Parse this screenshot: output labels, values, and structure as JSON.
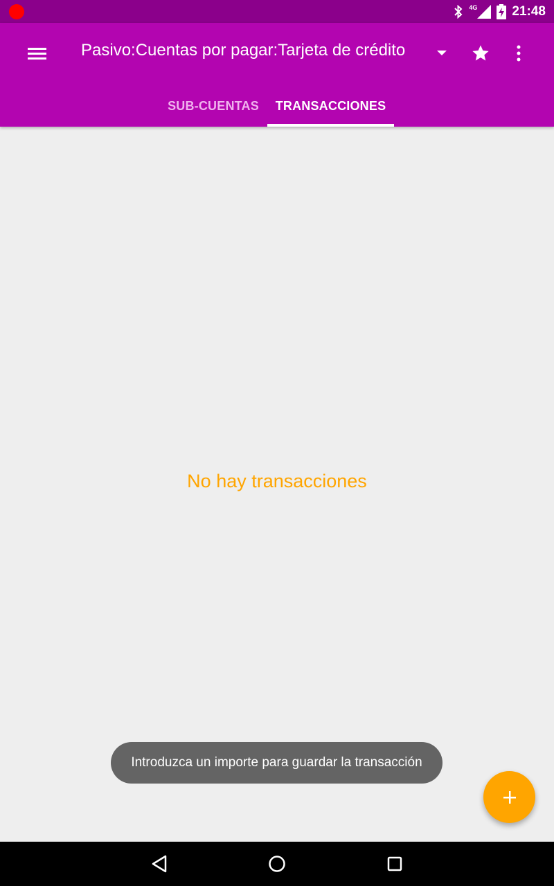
{
  "status_bar": {
    "time": "21:48",
    "network": "4G",
    "icons": [
      "recording-dot-icon",
      "bluetooth-icon",
      "signal-icon",
      "battery-charging-icon"
    ]
  },
  "toolbar": {
    "title": "Pasivo:Cuentas por pagar:Tarjeta de crédito",
    "icons": [
      "menu-icon",
      "dropdown-arrow-icon",
      "star-icon",
      "overflow-menu-icon"
    ]
  },
  "tabs": [
    {
      "label": "SUB-CUENTAS",
      "selected": false
    },
    {
      "label": "TRANSACCIONES",
      "selected": true
    }
  ],
  "main": {
    "empty_message": "No hay transacciones"
  },
  "toast": {
    "message": "Introduzca un importe para guardar la transacción"
  },
  "fab": {
    "icon": "plus-icon"
  },
  "nav_bar": {
    "icons": [
      "back-icon",
      "home-icon",
      "recents-icon"
    ]
  },
  "colors": {
    "status_bar": "#8b008b",
    "toolbar": "#b305b0",
    "accent": "#ffa500",
    "background": "#eeeeee"
  }
}
